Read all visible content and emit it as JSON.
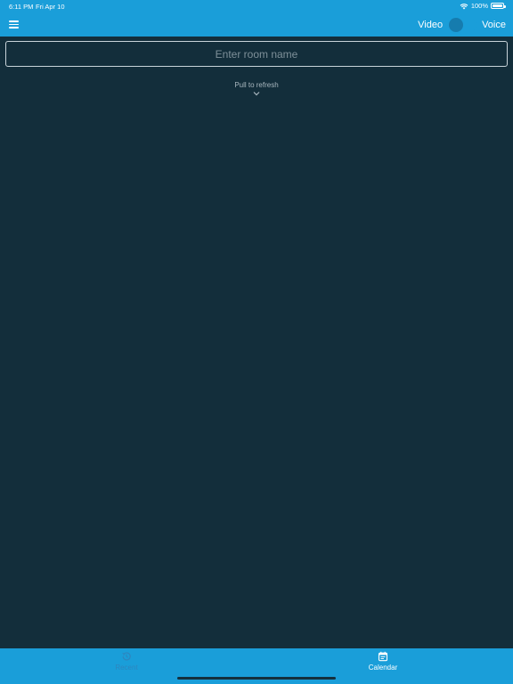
{
  "status_bar": {
    "time": "6:11 PM",
    "date": "Fri Apr 10",
    "battery_percent": "100%",
    "wifi_icon": "wifi-icon",
    "battery_icon": "battery-icon"
  },
  "header": {
    "menu_icon": "hamburger-menu-icon",
    "video_label": "Video",
    "voice_label": "Voice",
    "toggle_state": "video"
  },
  "room_input": {
    "value": "",
    "placeholder": "Enter room name"
  },
  "pull_to_refresh": {
    "label": "Pull to refresh",
    "icon": "chevron-down-icon"
  },
  "tabs": [
    {
      "label": "Recent",
      "icon": "history-icon",
      "active": false
    },
    {
      "label": "Calendar",
      "icon": "calendar-icon",
      "active": true
    }
  ],
  "colors": {
    "accent": "#1a9ed9",
    "background": "#132e3b",
    "inactive_tab": "#2d86bf"
  }
}
